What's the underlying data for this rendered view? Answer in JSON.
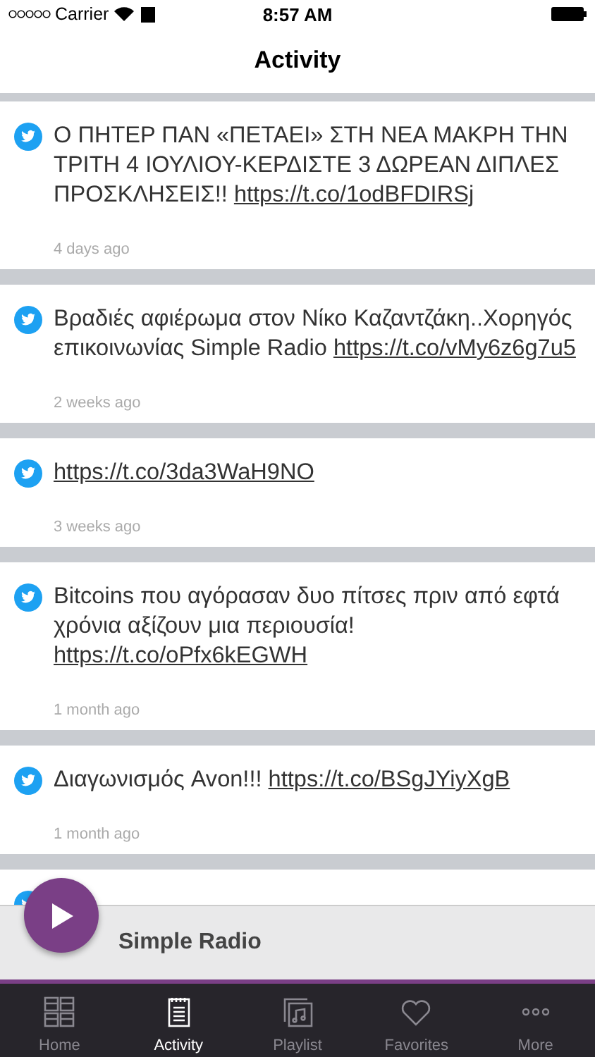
{
  "status_bar": {
    "carrier": "Carrier",
    "time": "8:57 AM"
  },
  "nav": {
    "title": "Activity"
  },
  "tweets": [
    {
      "text": "Ο  ΠΗΤΕΡ ΠΑΝ «ΠΕΤΑΕΙ» ΣΤΗ ΝΕΑ ΜΑΚΡΗ ΤΗΝ ΤΡΙΤΗ 4 ΙΟΥΛΙΟΥ-ΚΕΡΔΙΣΤΕ 3 ΔΩΡΕΑΝ ΔΙΠΛΕΣ ΠΡΟΣΚΛΗΣΕΙΣ!!",
      "link": "https://t.co/1odBFDIRSj",
      "time": "4 days ago"
    },
    {
      "text": "Βραδιές αφιέρωμα στον Νίκο Καζαντζάκη..Χορηγός επικοινωνίας Simple Radio",
      "link": "https://t.co/vMy6z6g7u5",
      "time": "2 weeks ago"
    },
    {
      "link": "https://t.co/3da3WaH9NO",
      "time": "3 weeks ago"
    },
    {
      "text": "Bitcoins που αγόρασαν δυο πίτσες πριν από εφτά χρόνια αξίζουν μια περιουσία!",
      "link": "https://t.co/oPfx6kEGWH",
      "time": "1 month ago"
    },
    {
      "text": "Διαγωνισμός Avon!!!",
      "link": "https://t.co/BSgJYiyXgB",
      "time": "1 month ago"
    }
  ],
  "player": {
    "station": "Simple Radio"
  },
  "tabs": [
    {
      "kind": "grid",
      "label": "Home",
      "selected": false
    },
    {
      "kind": "notepad",
      "label": "Activity",
      "selected": true
    },
    {
      "kind": "playlist",
      "label": "Playlist",
      "selected": false
    },
    {
      "kind": "heart",
      "label": "Favorites",
      "selected": false
    },
    {
      "kind": "dots",
      "label": "More",
      "selected": false
    }
  ]
}
